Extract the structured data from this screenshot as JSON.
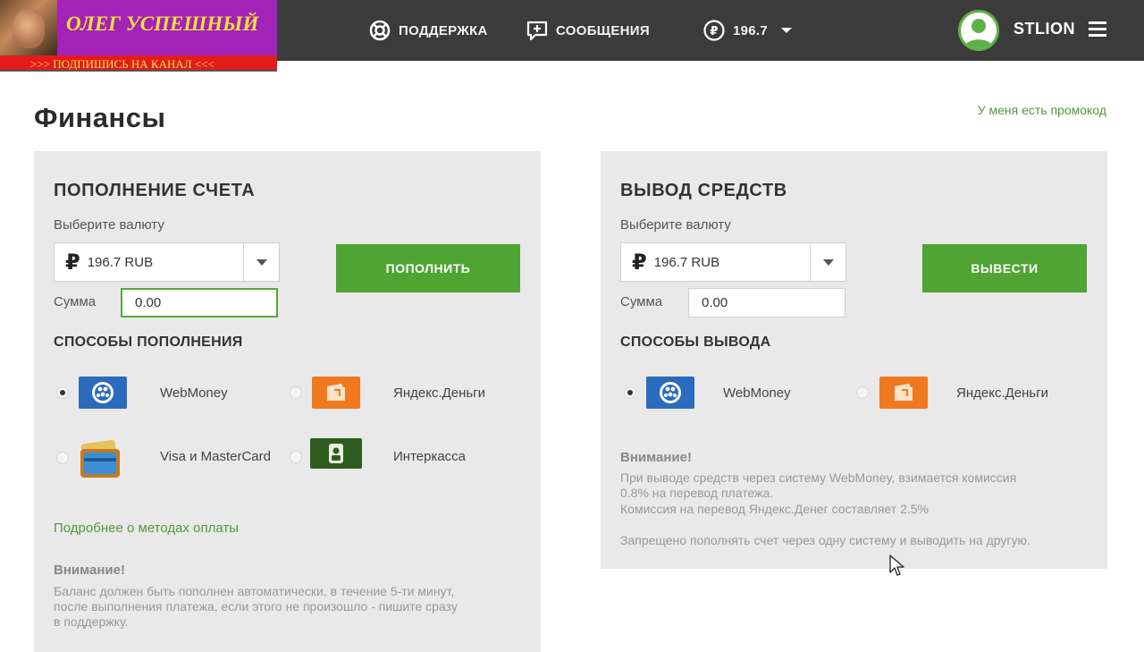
{
  "promo": {
    "title": "ОЛЕГ УСПЕШНЫЙ",
    "subtitle": ">>>  ПОДПИШИСЬ НА КАНАЛ  <<<"
  },
  "header": {
    "support": "ПОДДЕРЖКА",
    "messages": "СООБЩЕНИЯ",
    "balance": "196.7",
    "username": "STLION"
  },
  "page": {
    "title": "Финансы",
    "promo_link": "У меня есть промокод"
  },
  "deposit": {
    "title": "ПОПОЛНЕНИЕ СЧЕТА",
    "currency_label": "Выберите валюту",
    "currency_symbol": "₽",
    "currency_value": "196.7 RUB",
    "amount_label": "Сумма",
    "amount_value": "0.00",
    "button": "ПОПОЛНИТЬ",
    "methods_title": "СПОСОБЫ ПОПОЛНЕНИЯ",
    "methods": [
      {
        "name": "WebMoney",
        "icon": "webmoney-icon",
        "selected": true
      },
      {
        "name": "Яндекс.Деньги",
        "icon": "yandex-money-icon",
        "selected": false
      },
      {
        "name": "Visa и MasterCard",
        "icon": "card-wallet-icon",
        "selected": false
      },
      {
        "name": "Интеркасса",
        "icon": "interkassa-icon",
        "selected": false
      }
    ],
    "more_link": "Подробнее о методах оплаты",
    "note_title": "Внимание!",
    "note_lines": [
      "Баланс должен быть пополнен автоматически, в течение 5-ти минут,",
      "после выполнения платежа, если этого не произошло - пишите сразу",
      "в поддержку."
    ]
  },
  "withdraw": {
    "title": "ВЫВОД СРЕДСТВ",
    "currency_label": "Выберите валюту",
    "currency_symbol": "₽",
    "currency_value": "196.7 RUB",
    "amount_label": "Сумма",
    "amount_value": "0.00",
    "button": "ВЫВЕСТИ",
    "methods_title": "СПОСОБЫ ВЫВОДА",
    "methods": [
      {
        "name": "WebMoney",
        "icon": "webmoney-icon",
        "selected": true
      },
      {
        "name": "Яндекс.Деньги",
        "icon": "yandex-money-icon",
        "selected": false
      }
    ],
    "note_title": "Внимание!",
    "note_lines": [
      "При выводе средств через систему WebMoney, взимается комиссия",
      "0.8% на перевод платежа.",
      "Комиссия на перевод Яндекс.Денег составляет 2.5%"
    ],
    "note_extra": "Запрещено пополнять счет через одну систему и выводить на другую."
  },
  "colors": {
    "topbar": "#3b3b3b",
    "accent_green": "#4fa433",
    "panel_bg": "#e9e9e9",
    "link_green": "#4f9a3a"
  }
}
